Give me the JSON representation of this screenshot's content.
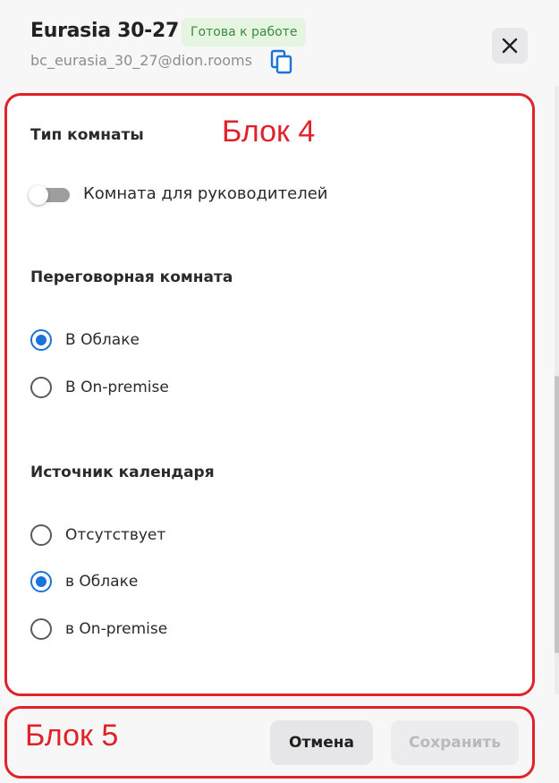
{
  "header": {
    "title": "Eurasia 30-27",
    "status": "Готова к работе",
    "email": "bc_eurasia_30_27@dion.rooms"
  },
  "annotations": {
    "block4": "Блок 4",
    "block5": "Блок 5"
  },
  "room_type": {
    "title": "Тип комнаты",
    "toggle_label": "Комната для руководителей",
    "toggle_on": false
  },
  "meeting_room": {
    "title": "Переговорная комната",
    "options": [
      {
        "label": "В Облаке",
        "checked": true
      },
      {
        "label": "В On-premise",
        "checked": false
      }
    ]
  },
  "calendar_source": {
    "title": "Источник календаря",
    "options": [
      {
        "label": "Отсутствует",
        "checked": false
      },
      {
        "label": "в Облаке",
        "checked": true
      },
      {
        "label": "в On-premise",
        "checked": false
      }
    ]
  },
  "footer": {
    "cancel": "Отмена",
    "save": "Сохранить"
  },
  "colors": {
    "accent": "#1a73d8",
    "annotation": "#e0222a",
    "status_bg": "#e6f5e2",
    "status_text": "#3b8a3e"
  },
  "icons": [
    "copy-icon",
    "close-icon"
  ]
}
